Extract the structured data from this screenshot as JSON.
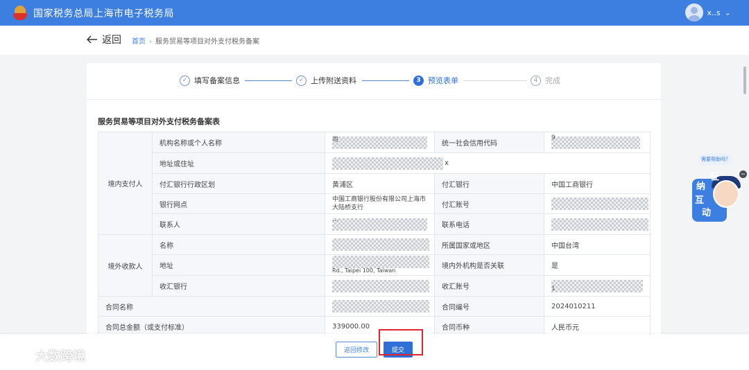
{
  "header": {
    "title": "国家税务总局上海市电子税务局",
    "user_name": "x..s",
    "user_caret": "⌄"
  },
  "nav": {
    "back_label": "返回",
    "breadcrumb_home": "首页",
    "breadcrumb_sep": "›",
    "breadcrumb_current": "服务贸易等项目对外支付税务备案"
  },
  "steps": [
    {
      "label": "填写备案信息",
      "status": "done",
      "glyph": "✓"
    },
    {
      "label": "上传附送资料",
      "status": "done",
      "glyph": "✓"
    },
    {
      "label": "预览表单",
      "status": "active",
      "glyph": "3"
    },
    {
      "label": "完成",
      "status": "pending",
      "glyph": "4"
    }
  ],
  "form": {
    "title": "服务贸易等项目对外支付税务备案表",
    "domestic_payer": "境内支付人",
    "foreign_payee": "境外收款人",
    "labels": {
      "org_name": "机构名称或个人名称",
      "credit_code": "统一社会信用代码",
      "address": "地址或住址",
      "bank_region": "付汇银行行政区划",
      "pay_bank": "付汇银行",
      "bank_branch": "银行网点",
      "pay_account": "付汇账号",
      "contact": "联系人",
      "phone": "联系电话",
      "payee_name": "名称",
      "payee_region": "所属国家或地区",
      "payee_address": "地址",
      "related": "境内外机构是否关联",
      "recv_bank": "收汇银行",
      "recv_account": "收汇账号",
      "contract_name": "合同名称",
      "contract_no": "合同编号",
      "contract_amount": "合同总金额（或支付标准）",
      "currency": "合同币种"
    },
    "values": {
      "org_name_partial": "司",
      "credit_code_partial": "9",
      "address_partial": "x",
      "bank_region": "黄浦区",
      "pay_bank": "中国工商银行",
      "bank_branch": "中国工商银行股份有限公司上海市大陆桥支行",
      "contact_partial": "…",
      "payee_region": "中国台湾",
      "payee_address_partial": "Rd., Taipei 100, Taiwan",
      "related": "是",
      "recv_account_partial": "1",
      "contract_no": "2024010211",
      "contract_amount": "339000.00",
      "currency": "人民币元"
    }
  },
  "actions": {
    "modify_label": "返回修改",
    "submit_label": "提交"
  },
  "helper": {
    "tip": "需要帮助吗？",
    "chars": [
      "征",
      "纳",
      "互",
      "动"
    ],
    "close_glyph": "−"
  },
  "watermark": {
    "text": "大数跨境"
  }
}
